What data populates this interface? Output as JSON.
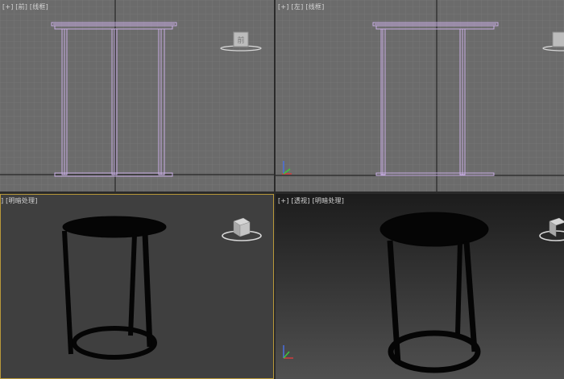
{
  "viewports": {
    "front": {
      "label": "[+] [前] [线框]"
    },
    "left": {
      "label_parts": [
        "[+]",
        "[左]",
        "[线框]"
      ]
    },
    "perspective_left": {
      "label": "[+] [透视] [明暗处理]"
    },
    "perspective_right": {
      "label_parts": [
        "[+]",
        "[透视]",
        "[明暗处理]"
      ]
    }
  },
  "colors": {
    "grid_bg": "#6b6b6b",
    "grid_line": "#7d7d7d",
    "grid_axis": "#262626",
    "wire": "#c9aee6",
    "shaded_bg": "#3f3f3f",
    "active_border": "#b8983a",
    "model": "#050505"
  },
  "view_cube": {
    "front_face": "前",
    "icon": "view-cube-icon"
  },
  "axis_gizmo_icon": "axis-tripod-icon"
}
